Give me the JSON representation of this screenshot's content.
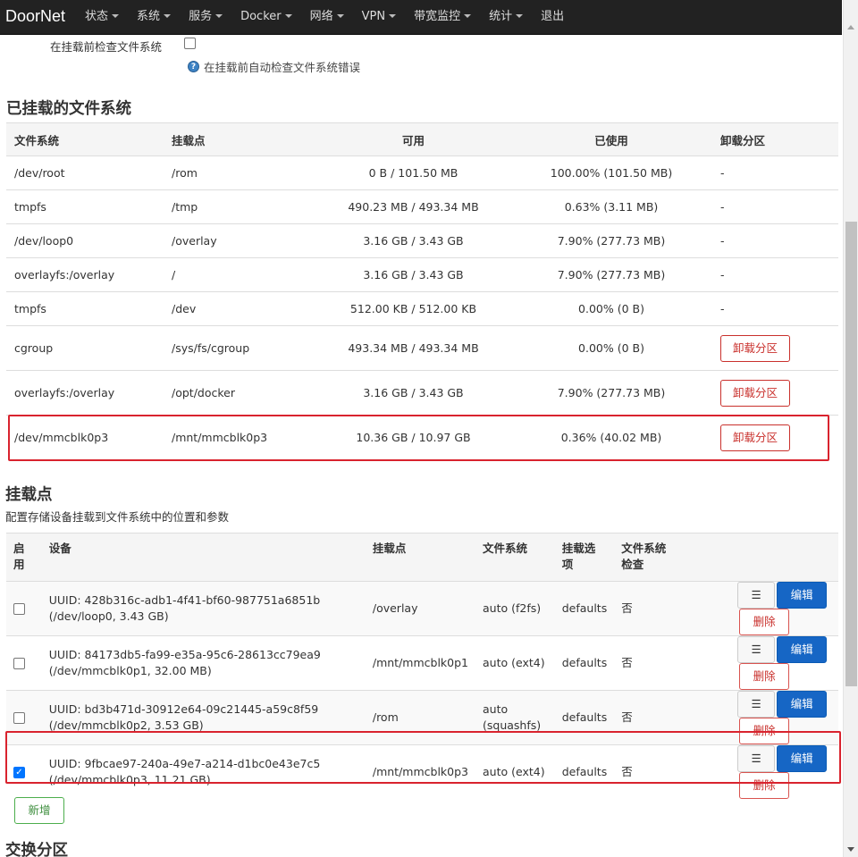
{
  "navbar": {
    "brand": "DoorNet",
    "menu": [
      "状态",
      "系统",
      "服务",
      "Docker",
      "网络",
      "VPN",
      "带宽监控",
      "统计",
      "退出"
    ]
  },
  "fsck": {
    "label": "在挂载前检查文件系统",
    "hint": "在挂载前自动检查文件系统错误"
  },
  "mounted": {
    "title": "已挂载的文件系统",
    "headers": [
      "文件系统",
      "挂载点",
      "可用",
      "已使用",
      "卸载分区"
    ],
    "rows": [
      {
        "fs": "/dev/root",
        "mount": "/rom",
        "avail": "0 B / 101.50 MB",
        "used": "100.00% (101.50 MB)",
        "action": "-"
      },
      {
        "fs": "tmpfs",
        "mount": "/tmp",
        "avail": "490.23 MB / 493.34 MB",
        "used": "0.63% (3.11 MB)",
        "action": "-"
      },
      {
        "fs": "/dev/loop0",
        "mount": "/overlay",
        "avail": "3.16 GB / 3.43 GB",
        "used": "7.90% (277.73 MB)",
        "action": "-"
      },
      {
        "fs": "overlayfs:/overlay",
        "mount": "/",
        "avail": "3.16 GB / 3.43 GB",
        "used": "7.90% (277.73 MB)",
        "action": "-"
      },
      {
        "fs": "tmpfs",
        "mount": "/dev",
        "avail": "512.00 KB / 512.00 KB",
        "used": "0.00% (0 B)",
        "action": "-"
      },
      {
        "fs": "cgroup",
        "mount": "/sys/fs/cgroup",
        "avail": "493.34 MB / 493.34 MB",
        "used": "0.00% (0 B)",
        "action": "卸载分区"
      },
      {
        "fs": "overlayfs:/overlay",
        "mount": "/opt/docker",
        "avail": "3.16 GB / 3.43 GB",
        "used": "7.90% (277.73 MB)",
        "action": "卸载分区"
      },
      {
        "fs": "/dev/mmcblk0p3",
        "mount": "/mnt/mmcblk0p3",
        "avail": "10.36 GB / 10.97 GB",
        "used": "0.36% (40.02 MB)",
        "action": "卸载分区"
      }
    ]
  },
  "mountpoints": {
    "title": "挂载点",
    "description": "配置存储设备挂载到文件系统中的位置和参数",
    "headers": [
      "启用",
      "设备",
      "挂载点",
      "文件系统",
      "挂载选项",
      "文件系统检查"
    ],
    "rows": [
      {
        "enabled": false,
        "uuid": "UUID: 428b316c-adb1-4f41-bf60-987751a6851b",
        "dev": "(/dev/loop0, 3.43 GB)",
        "mount": "/overlay",
        "fs": "auto (f2fs)",
        "opts": "defaults",
        "check": "否"
      },
      {
        "enabled": false,
        "uuid": "UUID: 84173db5-fa99-e35a-95c6-28613cc79ea9",
        "dev": "(/dev/mmcblk0p1, 32.00 MB)",
        "mount": "/mnt/mmcblk0p1",
        "fs": "auto (ext4)",
        "opts": "defaults",
        "check": "否"
      },
      {
        "enabled": false,
        "uuid": "UUID: bd3b471d-30912e64-09c21445-a59c8f59",
        "dev": "(/dev/mmcblk0p2, 3.53 GB)",
        "mount": "/rom",
        "fs": "auto (squashfs)",
        "opts": "defaults",
        "check": "否"
      },
      {
        "enabled": true,
        "uuid": "UUID: 9fbcae97-240a-49e7-a214-d1bc0e43e7c5",
        "dev": "(/dev/mmcblk0p3, 11.21 GB)",
        "mount": "/mnt/mmcblk0p3",
        "fs": "auto (ext4)",
        "opts": "defaults",
        "check": "否"
      }
    ],
    "buttons": {
      "menu": "☰",
      "edit": "编辑",
      "delete": "删除"
    },
    "add": "新增"
  },
  "swap": {
    "title": "交换分区"
  },
  "colors": {
    "navbar": "#222222",
    "highlight": "#d9232e",
    "edit": "#1666c5",
    "danger": "#c9302c",
    "add": "#4cae4c"
  }
}
